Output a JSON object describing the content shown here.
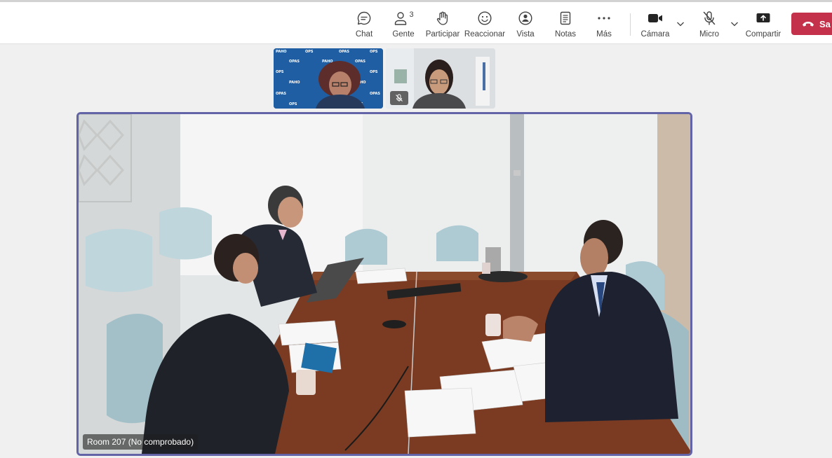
{
  "toolbar": {
    "chat": "Chat",
    "people": "Gente",
    "people_count": "3",
    "raise_hand": "Participar",
    "react": "Reaccionar",
    "view": "Vista",
    "notes": "Notas",
    "more": "Más",
    "camera": "Cámara",
    "mic": "Micro",
    "share": "Compartir",
    "leave": "Sa"
  },
  "thumbnails": [
    {
      "backdrop_logos": [
        "PAHO",
        "OPS",
        "OPAS"
      ]
    },
    {
      "muted": true
    }
  ],
  "main_video": {
    "participant_label": "Room 207 (No comprobado)"
  },
  "colors": {
    "accent": "#6264a7",
    "leave": "#c4314b"
  }
}
